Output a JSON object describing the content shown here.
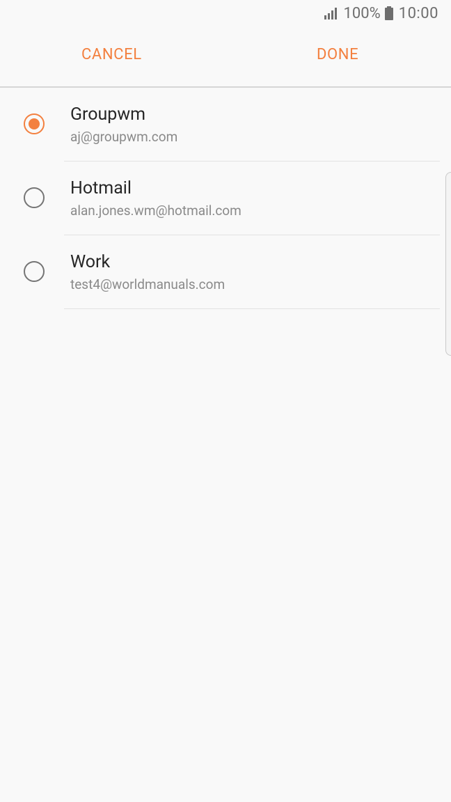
{
  "status_bar": {
    "battery_percent": "100%",
    "time": "10:00",
    "signal_icon": "signal-icon",
    "battery_icon": "battery-icon"
  },
  "action_bar": {
    "cancel_label": "CANCEL",
    "done_label": "DONE"
  },
  "accounts": [
    {
      "name": "Groupwm",
      "email": "aj@groupwm.com",
      "selected": true
    },
    {
      "name": "Hotmail",
      "email": "alan.jones.wm@hotmail.com",
      "selected": false
    },
    {
      "name": "Work",
      "email": "test4@worldmanuals.com",
      "selected": false
    }
  ],
  "colors": {
    "accent": "#f3803f",
    "background": "#f9f9f9",
    "primary_text": "#262626",
    "secondary_text": "#8a8a8a"
  }
}
